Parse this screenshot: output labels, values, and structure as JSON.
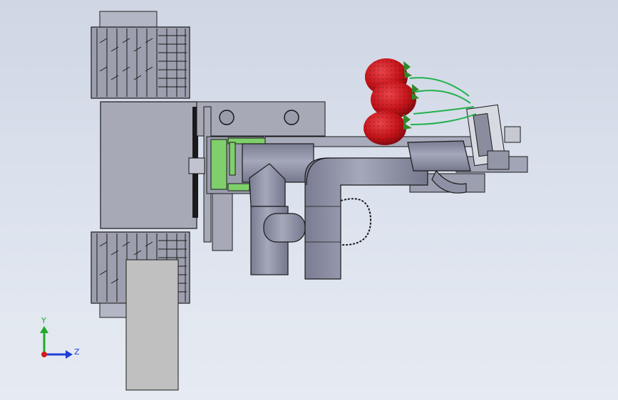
{
  "viewport": {
    "background_top": "#cfd6e4",
    "background_bottom": "#e6ebf2"
  },
  "triad": {
    "y_label": "Y",
    "z_label": "Z",
    "y_color": "#1faa2a",
    "z_color": "#1d3fd6",
    "x_color": "#d21c1c"
  },
  "model": {
    "body_color": "#a6a9b8",
    "pipe_color": "#8e91a6",
    "bracket_color": "#7fd06a",
    "wire_color": "#22b14c",
    "fruit_color": "#c4141a",
    "leaf_color": "#2f8a2a"
  }
}
